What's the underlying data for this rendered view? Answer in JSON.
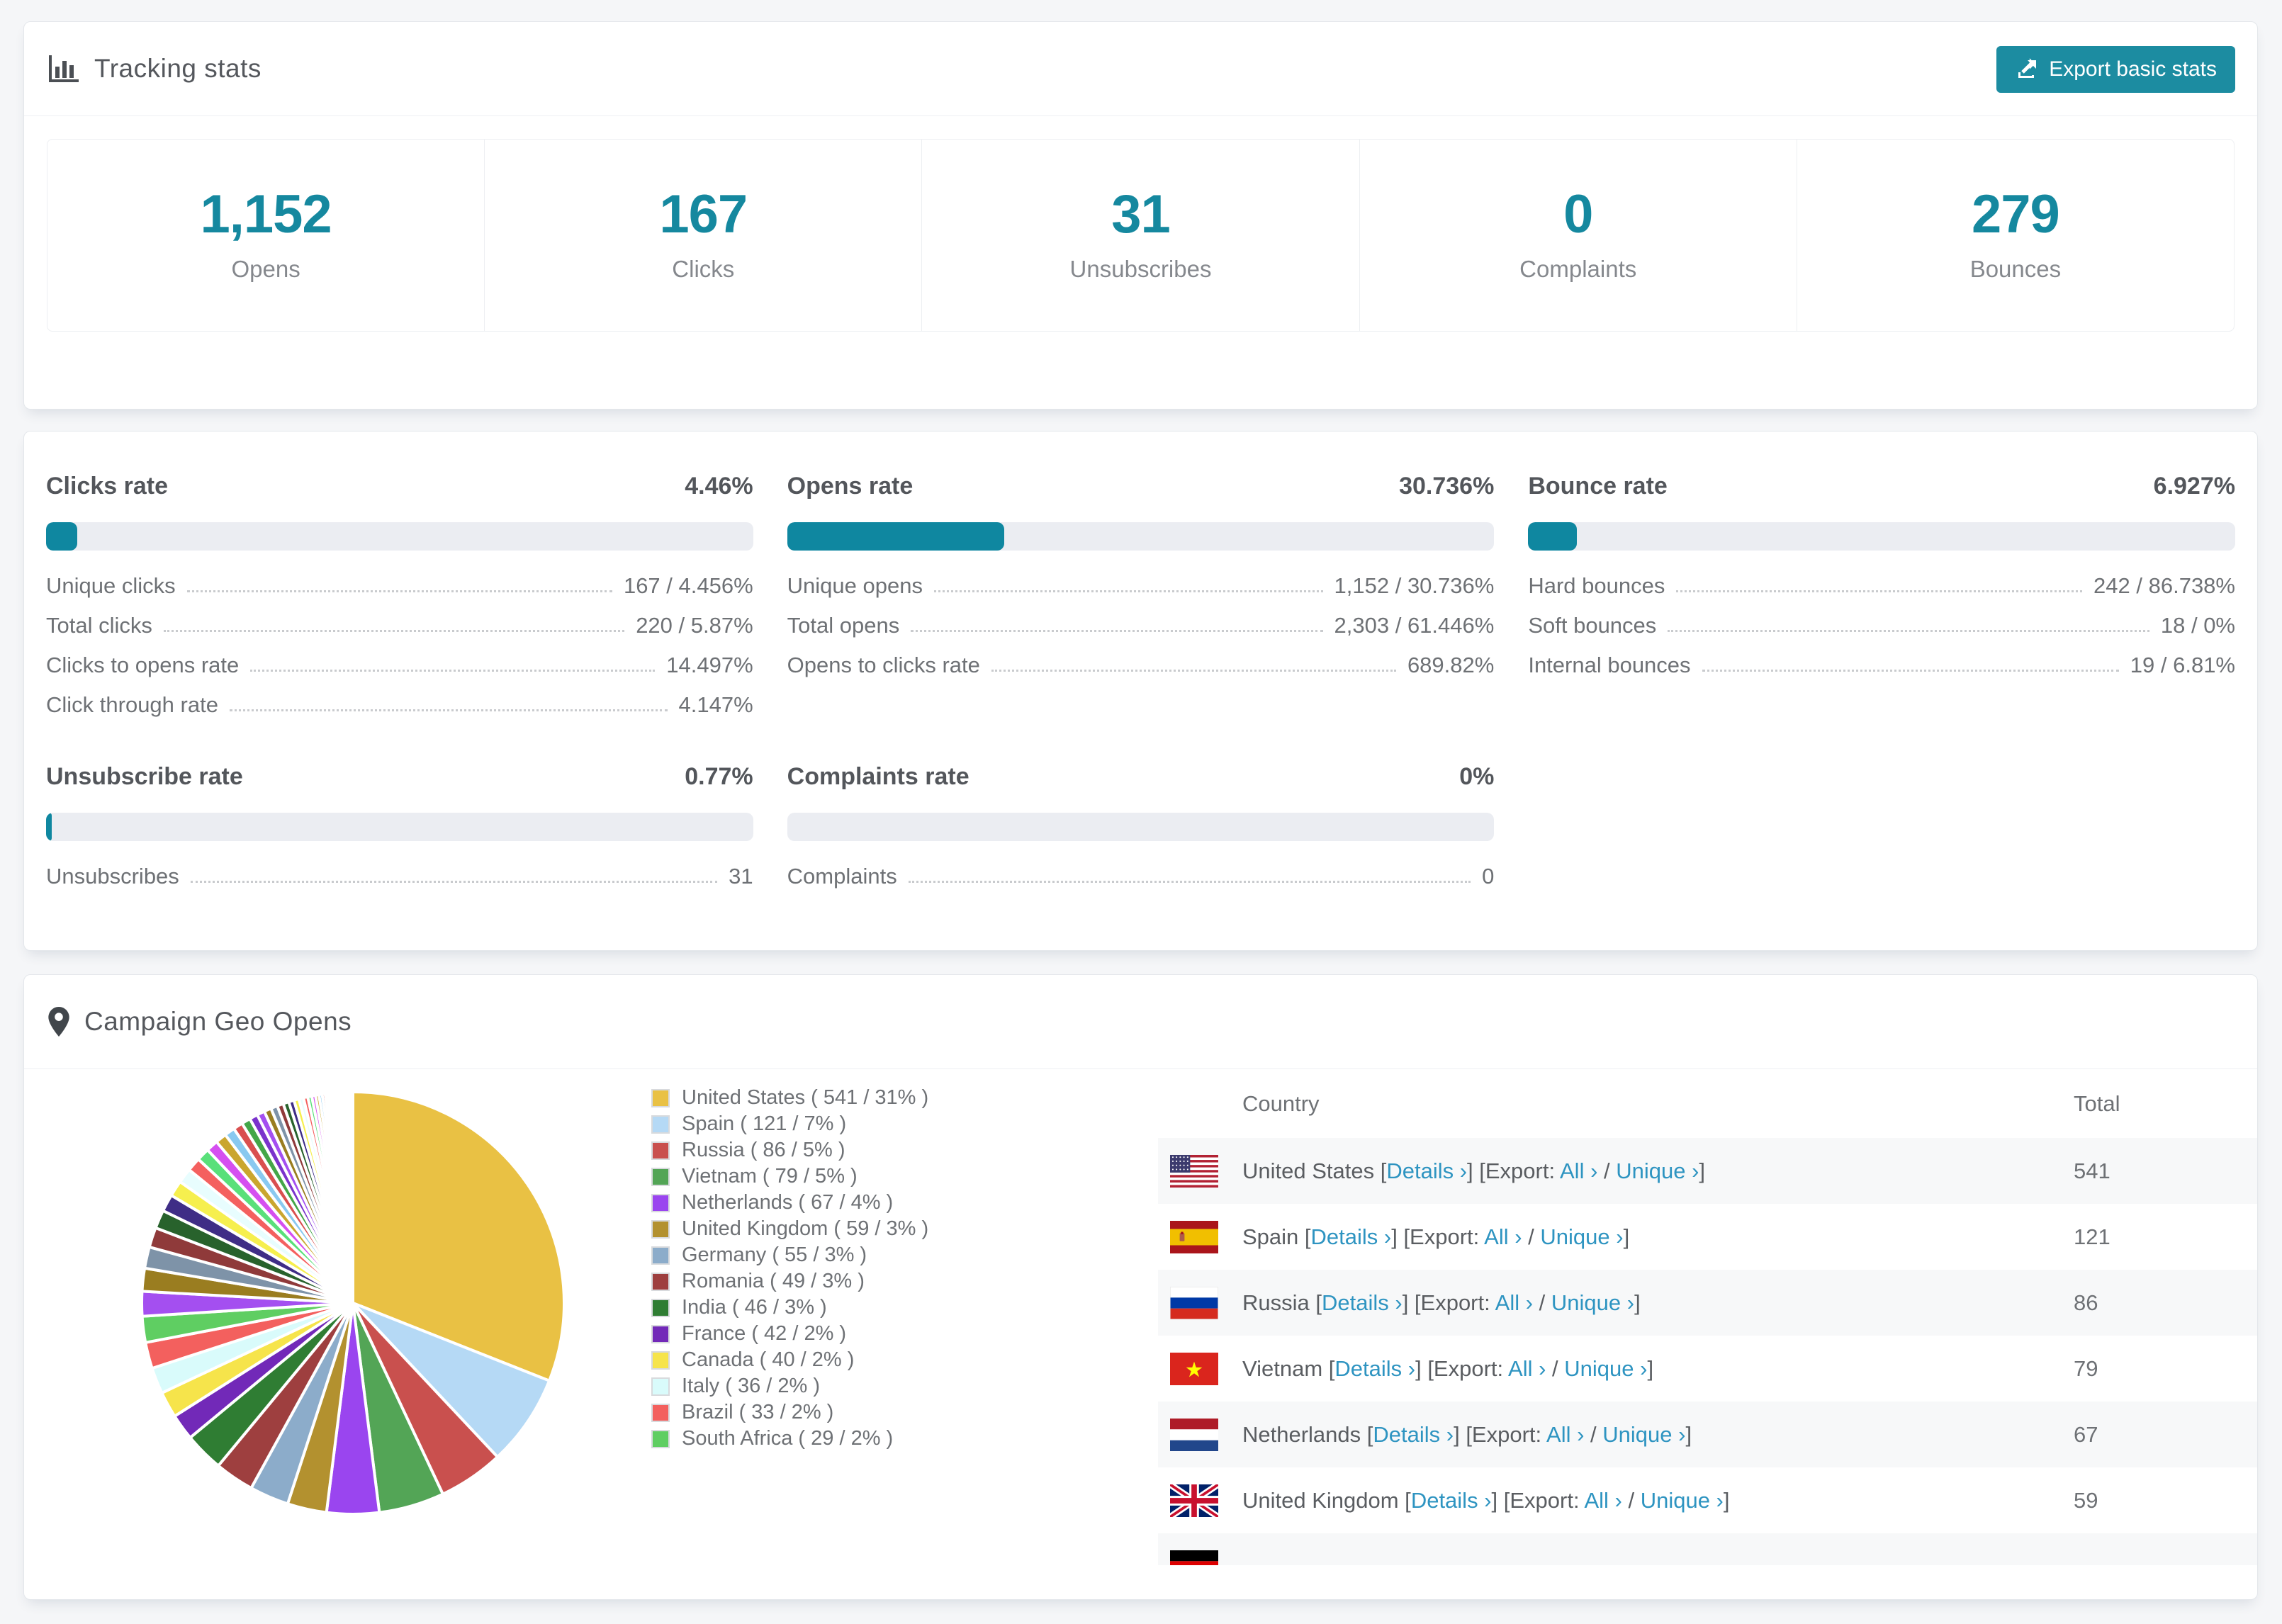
{
  "colors": {
    "accent": "#15889f",
    "button": "#1c8ca1",
    "link": "#2e94c1",
    "progress_fill": "#0f87a0",
    "progress_track": "#ebedf2"
  },
  "tracking": {
    "title": "Tracking stats",
    "export_label": "Export basic stats",
    "stats": [
      {
        "value": "1,152",
        "label": "Opens"
      },
      {
        "value": "167",
        "label": "Clicks"
      },
      {
        "value": "31",
        "label": "Unsubscribes"
      },
      {
        "value": "0",
        "label": "Complaints"
      },
      {
        "value": "279",
        "label": "Bounces"
      }
    ]
  },
  "rates": {
    "blocks": [
      {
        "title": "Clicks rate",
        "value": "4.46%",
        "pct": 4.46,
        "slot": 0,
        "rows": [
          {
            "label": "Unique clicks",
            "value": "167 / 4.456%"
          },
          {
            "label": "Total clicks",
            "value": "220 / 5.87%"
          },
          {
            "label": "Clicks to opens rate",
            "value": "14.497%"
          },
          {
            "label": "Click through rate",
            "value": "4.147%"
          }
        ]
      },
      {
        "title": "Opens rate",
        "value": "30.736%",
        "pct": 30.736,
        "slot": 1,
        "rows": [
          {
            "label": "Unique opens",
            "value": "1,152 / 30.736%"
          },
          {
            "label": "Total opens",
            "value": "2,303 / 61.446%"
          },
          {
            "label": "Opens to clicks rate",
            "value": "689.82%"
          }
        ]
      },
      {
        "title": "Bounce rate",
        "value": "6.927%",
        "pct": 6.927,
        "slot": 2,
        "rows": [
          {
            "label": "Hard bounces",
            "value": "242 / 86.738%"
          },
          {
            "label": "Soft bounces",
            "value": "18 / 0%"
          },
          {
            "label": "Internal bounces",
            "value": "19 / 6.81%"
          }
        ]
      },
      {
        "title": "Unsubscribe rate",
        "value": "0.77%",
        "pct": 0.77,
        "slot": 3,
        "rows": [
          {
            "label": "Unsubscribes",
            "value": "31"
          }
        ]
      },
      {
        "title": "Complaints rate",
        "value": "0%",
        "pct": 0,
        "slot": 4,
        "rows": [
          {
            "label": "Complaints",
            "value": "0"
          }
        ]
      }
    ]
  },
  "geo": {
    "title": "Campaign Geo Opens",
    "table": {
      "headers": [
        "Country",
        "Total"
      ],
      "details_label": "Details",
      "export_label": "Export:",
      "all_label": "All",
      "unique_label": "Unique",
      "chevron": "›",
      "rows": [
        {
          "flag": "us",
          "country": "United States",
          "total": "541"
        },
        {
          "flag": "es",
          "country": "Spain",
          "total": "121"
        },
        {
          "flag": "ru",
          "country": "Russia",
          "total": "86"
        },
        {
          "flag": "vn",
          "country": "Vietnam",
          "total": "79"
        },
        {
          "flag": "nl",
          "country": "Netherlands",
          "total": "67"
        },
        {
          "flag": "gb",
          "country": "United Kingdom",
          "total": "59"
        },
        {
          "flag": "de",
          "country": "",
          "total": ""
        }
      ]
    }
  },
  "chart_data": {
    "type": "pie",
    "title": "Campaign Geo Opens",
    "legend_position": "right",
    "series": [
      {
        "name": "United States",
        "opens": 541,
        "pct": 31,
        "color": "#e9c144"
      },
      {
        "name": "Spain",
        "opens": 121,
        "pct": 7,
        "color": "#b5d9f5"
      },
      {
        "name": "Russia",
        "opens": 86,
        "pct": 5,
        "color": "#c9504e"
      },
      {
        "name": "Vietnam",
        "opens": 79,
        "pct": 5,
        "color": "#53a556"
      },
      {
        "name": "Netherlands",
        "opens": 67,
        "pct": 4,
        "color": "#9a45ef"
      },
      {
        "name": "United Kingdom",
        "opens": 59,
        "pct": 3,
        "color": "#b3912f"
      },
      {
        "name": "Germany",
        "opens": 55,
        "pct": 3,
        "color": "#8cacca"
      },
      {
        "name": "Romania",
        "opens": 49,
        "pct": 3,
        "color": "#9e3f3f"
      },
      {
        "name": "India",
        "opens": 46,
        "pct": 3,
        "color": "#2f7d33"
      },
      {
        "name": "France",
        "opens": 42,
        "pct": 2,
        "color": "#7229b8"
      },
      {
        "name": "Canada",
        "opens": 40,
        "pct": 2,
        "color": "#f6e44b"
      },
      {
        "name": "Italy",
        "opens": 36,
        "pct": 2,
        "color": "#d9fbfb"
      },
      {
        "name": "Brazil",
        "opens": 33,
        "pct": 2,
        "color": "#f3605e"
      },
      {
        "name": "South Africa",
        "opens": 29,
        "pct": 2,
        "color": "#5fce62"
      }
    ],
    "others": {
      "total_pct": 26,
      "approx_slices": 46,
      "decay": 0.93,
      "palette": [
        "#a44ff0",
        "#9a7d20",
        "#7e93a8",
        "#8f3a3a",
        "#28622c",
        "#3f2d86",
        "#f6ef4e",
        "#e8fdfe",
        "#f4605f",
        "#59e07a",
        "#d54ff0",
        "#caa62e",
        "#89c9f0",
        "#d94f4f",
        "#44a648",
        "#7a33cc"
      ]
    }
  }
}
